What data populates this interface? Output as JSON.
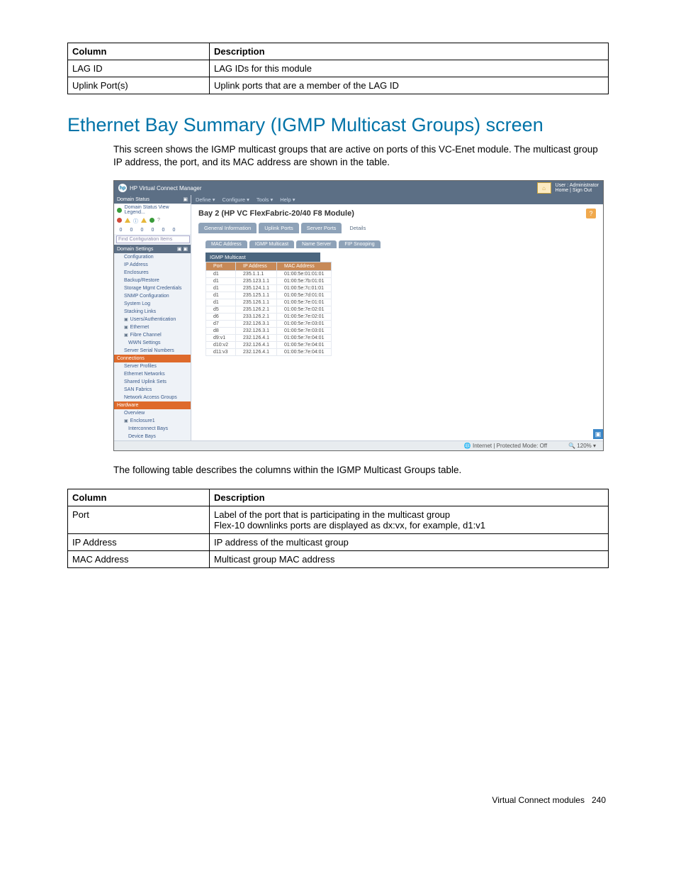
{
  "table1": {
    "headers": [
      "Column",
      "Description"
    ],
    "rows": [
      [
        "LAG ID",
        "LAG IDs for this module"
      ],
      [
        "Uplink Port(s)",
        "Uplink ports that are a member of the LAG ID"
      ]
    ]
  },
  "heading": "Ethernet Bay Summary (IGMP Multicast Groups) screen",
  "intro": "This screen shows the IGMP multicast groups that are active on ports of this VC-Enet module. The multicast group IP address, the port, and its MAC address are shown in the table.",
  "screenshot": {
    "app_title": "HP Virtual Connect Manager",
    "logo_text": "hp",
    "user_line1": "User : Administrator",
    "user_line2": "Home  |  Sign Out",
    "sidebar": {
      "domain_status": "Domain Status",
      "domain_status_link": "Domain Status    View Legend...",
      "icon_counts": [
        "0",
        "0",
        "0",
        "0",
        "0",
        "0"
      ],
      "find_placeholder": "Find Configuration Items",
      "domain_settings": "Domain Settings",
      "items1": [
        "Configuration",
        "IP Address",
        "Enclosures",
        "Backup/Restore",
        "Storage Mgmt Credentials",
        "SNMP Configuration",
        "System Log",
        "Stacking Links"
      ],
      "items2": [
        {
          "label": "Users/Authentication",
          "icon": true
        },
        {
          "label": "Ethernet",
          "icon": true
        },
        {
          "label": "Fibre Channel",
          "icon": true
        },
        {
          "label": "WWN Settings",
          "icon": false,
          "indent": true
        },
        {
          "label": "Server Serial Numbers",
          "icon": false
        }
      ],
      "connections": "Connections",
      "items3": [
        "Server Profiles",
        "Ethernet Networks",
        "Shared Uplink Sets",
        "SAN Fabrics",
        "Network Access Groups"
      ],
      "hardware": "Hardware",
      "items4": [
        "Overview"
      ],
      "enclosure": "Enclosure1",
      "items5": [
        "Interconnect Bays",
        "Device Bays"
      ]
    },
    "menubar": [
      "Define ▾",
      "Configure ▾",
      "Tools ▾",
      "Help ▾"
    ],
    "main_title": "Bay 2 (HP VC FlexFabric-20/40 F8 Module)",
    "tabs": [
      "General Information",
      "Uplink Ports",
      "Server Ports",
      "Details"
    ],
    "subtabs": [
      "MAC Address",
      "IGMP Multicast",
      "Name Server",
      "FIP Snooping"
    ],
    "grid_title": "IGMP Multicast",
    "grid_headers": [
      "Port",
      "IP Address",
      "MAC Address"
    ],
    "grid_rows": [
      [
        "d1",
        "235.1.1.1",
        "01:00:5e:01:01:01"
      ],
      [
        "d1",
        "235.123.1.1",
        "01:00:5e:7b:01:01"
      ],
      [
        "d1",
        "235.124.1.1",
        "01:00:5e:7c:01:01"
      ],
      [
        "d1",
        "235.125.1.1",
        "01:00:5e:7d:01:01"
      ],
      [
        "d1",
        "235.126.1.1",
        "01:00:5e:7e:01:01"
      ],
      [
        "d5",
        "235.126.2.1",
        "01:00:5e:7e:02:01"
      ],
      [
        "d6",
        "233.126.2.1",
        "01:00:5e:7e:02:01"
      ],
      [
        "d7",
        "232.126.3.1",
        "01:00:5e:7e:03:01"
      ],
      [
        "d8",
        "232.126.3.1",
        "01:00:5e:7e:03:01"
      ],
      [
        "d9:v1",
        "232.126.4.1",
        "01:00:5e:7e:04:01"
      ],
      [
        "d10:v2",
        "232.126.4.1",
        "01:00:5e:7e:04:01"
      ],
      [
        "d11:v3",
        "232.126.4.1",
        "01:00:5e:7e:04:01"
      ]
    ],
    "status_left": "Internet | Protected Mode: Off",
    "status_right": "🔍 120%  ▾"
  },
  "after_screenshot": "The following table describes the columns within the IGMP Multicast Groups table.",
  "table2": {
    "headers": [
      "Column",
      "Description"
    ],
    "rows": [
      [
        "Port",
        "Label of the port that is participating in the multicast group\nFlex-10 downlinks ports are displayed as dx:vx, for example, d1:v1"
      ],
      [
        "IP Address",
        "IP address of the multicast group"
      ],
      [
        "MAC Address",
        "Multicast group MAC address"
      ]
    ]
  },
  "footer": {
    "section": "Virtual Connect modules",
    "page": "240"
  }
}
